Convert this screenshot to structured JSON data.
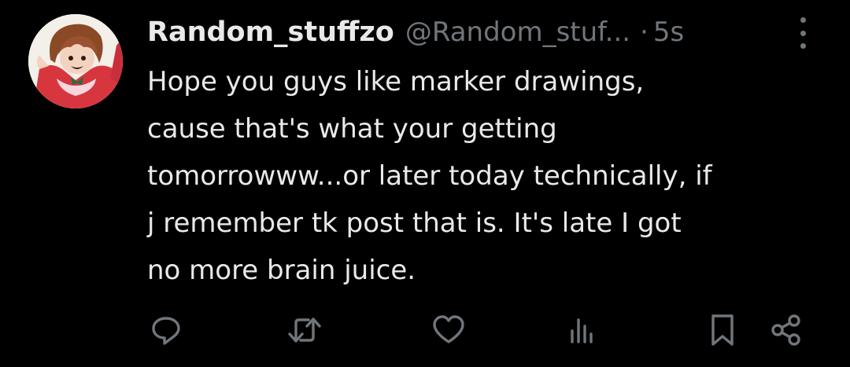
{
  "colors": {
    "background": "#000000",
    "primary_text": "#e7e9ea",
    "secondary_text": "#71767b"
  },
  "tweet": {
    "author": {
      "display_name": "Random_stuffzo",
      "handle": "@Random_stuf...",
      "avatar": "drawn-character-avatar"
    },
    "separator": "·",
    "timestamp": "5s",
    "text_lines": [
      "Hope you guys like marker drawings,",
      "cause that's what your getting",
      "tomorrowww...or later today technically, if",
      "j remember tk post that is. It's late I got",
      "no more brain juice."
    ],
    "actions": [
      {
        "name": "reply",
        "icon": "reply-icon"
      },
      {
        "name": "retweet",
        "icon": "retweet-icon"
      },
      {
        "name": "like",
        "icon": "heart-icon"
      },
      {
        "name": "views",
        "icon": "analytics-icon"
      },
      {
        "name": "bookmark",
        "icon": "bookmark-icon"
      },
      {
        "name": "share",
        "icon": "share-icon"
      }
    ]
  }
}
